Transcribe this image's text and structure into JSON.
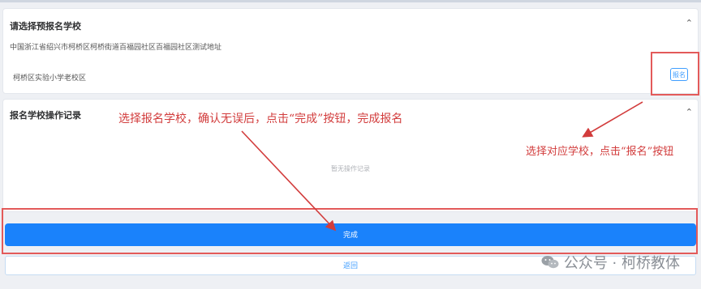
{
  "school_card": {
    "title": "请选择预报名学校",
    "address": "中国浙江省绍兴市柯桥区柯桥街道百福园社区百福园社区测试地址",
    "school_name": "柯桥区实验小学老校区",
    "signup_label": "报名"
  },
  "records_card": {
    "title": "报名学校操作记录",
    "empty_text": "暂无操作记录"
  },
  "buttons": {
    "finish_label": "完成",
    "back_label": "返回"
  },
  "annotations": {
    "step_finish": "选择报名学校，确认无误后，点击“完成”按钮，完成报名",
    "step_signup": "选择对应学校，点击“报名”按钮"
  },
  "watermark": {
    "text": "公众号 · 柯桥教体",
    "icon": "wechat-icon"
  },
  "colors": {
    "primary": "#1a82fb",
    "annotation": "#d23c3c"
  }
}
